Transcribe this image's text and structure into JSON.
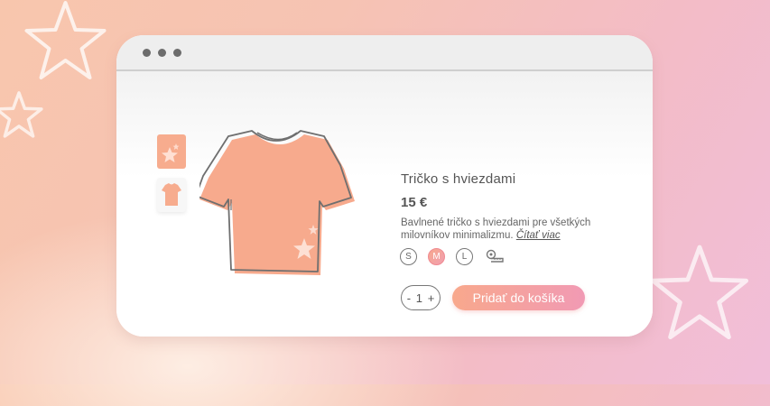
{
  "product": {
    "title": "Tričko s hviezdami",
    "price": "15 €",
    "description": "Bavlnené tričko s hviezdami pre všetkých milovníkov minimalizmu.",
    "read_more": "Čítať viac",
    "sizes": [
      "S",
      "M",
      "L"
    ],
    "selected_size": "M",
    "quantity": "1",
    "minus": "-",
    "plus": "+",
    "add_to_cart": "Pridať do košíka"
  },
  "colors": {
    "accent": "#f8a88c",
    "accent_end": "#f19ab4"
  },
  "icons": [
    "star-icon",
    "tshirt-icon",
    "measuring-tape-icon"
  ]
}
